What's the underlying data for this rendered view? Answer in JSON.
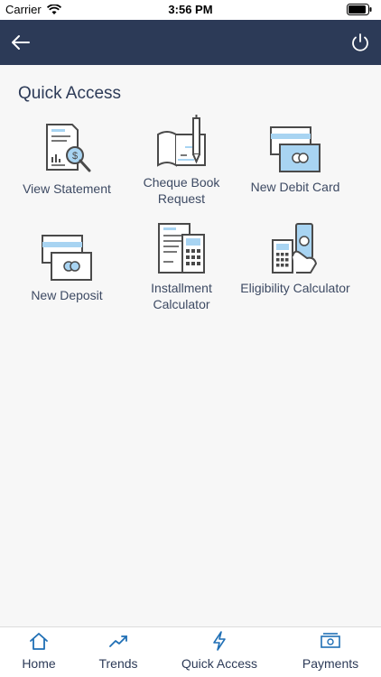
{
  "status": {
    "carrier": "Carrier",
    "time": "3:56 PM"
  },
  "section": {
    "title": "Quick Access"
  },
  "tiles": [
    {
      "label": "View Statement",
      "icon": "statement-icon"
    },
    {
      "label": "Cheque Book Request",
      "icon": "cheque-book-icon"
    },
    {
      "label": "New Debit Card",
      "icon": "debit-card-icon"
    },
    {
      "label": "New Deposit",
      "icon": "deposit-icon"
    },
    {
      "label": "Installment Calculator",
      "icon": "installment-calculator-icon"
    },
    {
      "label": "Eligibility Calculator",
      "icon": "eligibility-calculator-icon"
    }
  ],
  "tabs": [
    {
      "label": "Home",
      "icon": "home-icon"
    },
    {
      "label": "Trends",
      "icon": "trends-icon"
    },
    {
      "label": "Quick Access",
      "icon": "lightning-icon"
    },
    {
      "label": "Payments",
      "icon": "payments-icon"
    }
  ],
  "colors": {
    "navy": "#2c3a57",
    "accent_blue": "#a8d4f2",
    "icon_gray": "#4a4a4a",
    "tab_blue": "#1f6fb5"
  }
}
